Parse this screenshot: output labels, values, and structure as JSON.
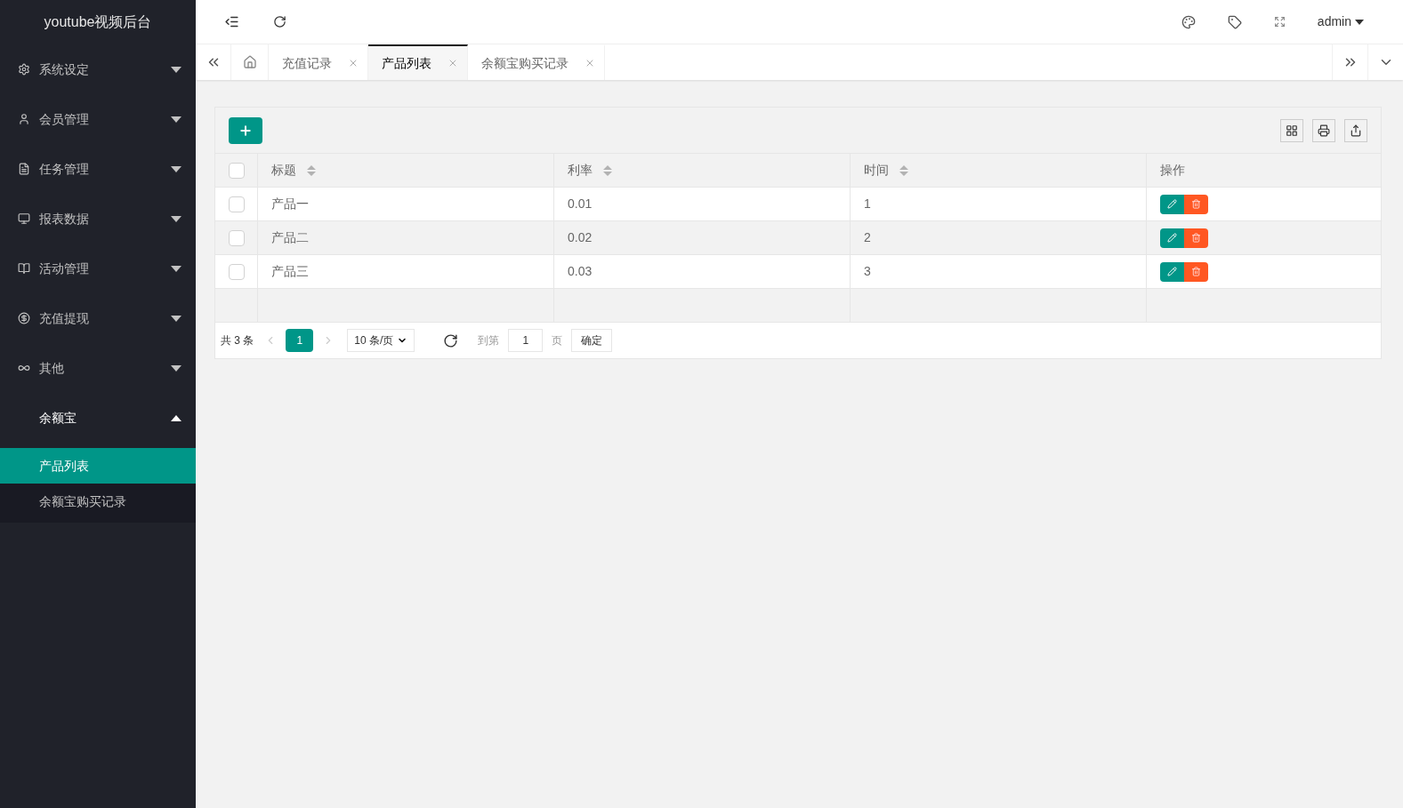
{
  "sidebar": {
    "title": "youtube视频后台",
    "items": [
      {
        "label": "系统设定",
        "expanded": false
      },
      {
        "label": "会员管理",
        "expanded": false
      },
      {
        "label": "任务管理",
        "expanded": false
      },
      {
        "label": "报表数据",
        "expanded": false
      },
      {
        "label": "活动管理",
        "expanded": false
      },
      {
        "label": "充值提现",
        "expanded": false
      },
      {
        "label": "其他",
        "expanded": false
      },
      {
        "label": "余额宝",
        "expanded": true,
        "children": [
          {
            "label": "产品列表",
            "selected": true
          },
          {
            "label": "余额宝购买记录",
            "selected": false
          }
        ]
      }
    ]
  },
  "header": {
    "user": "admin"
  },
  "tabs": [
    {
      "label": "充值记录",
      "selected": false
    },
    {
      "label": "产品列表",
      "selected": true
    },
    {
      "label": "余额宝购买记录",
      "selected": false
    }
  ],
  "table": {
    "columns": [
      "标题",
      "利率",
      "时间",
      "操作"
    ],
    "rows": [
      {
        "title": "产品一",
        "rate": "0.01",
        "time": "1",
        "checked": false
      },
      {
        "title": "产品二",
        "rate": "0.02",
        "time": "2",
        "checked": false
      },
      {
        "title": "产品三",
        "rate": "0.03",
        "time": "3",
        "checked": false
      }
    ],
    "header_checked": false
  },
  "pager": {
    "total": "共 3 条",
    "pages": [
      {
        "label": "1",
        "selected": true
      }
    ],
    "page_size": "10 条/页",
    "goto_label": "到第",
    "goto_value": "1",
    "page_unit": "页",
    "confirm": "确定"
  }
}
